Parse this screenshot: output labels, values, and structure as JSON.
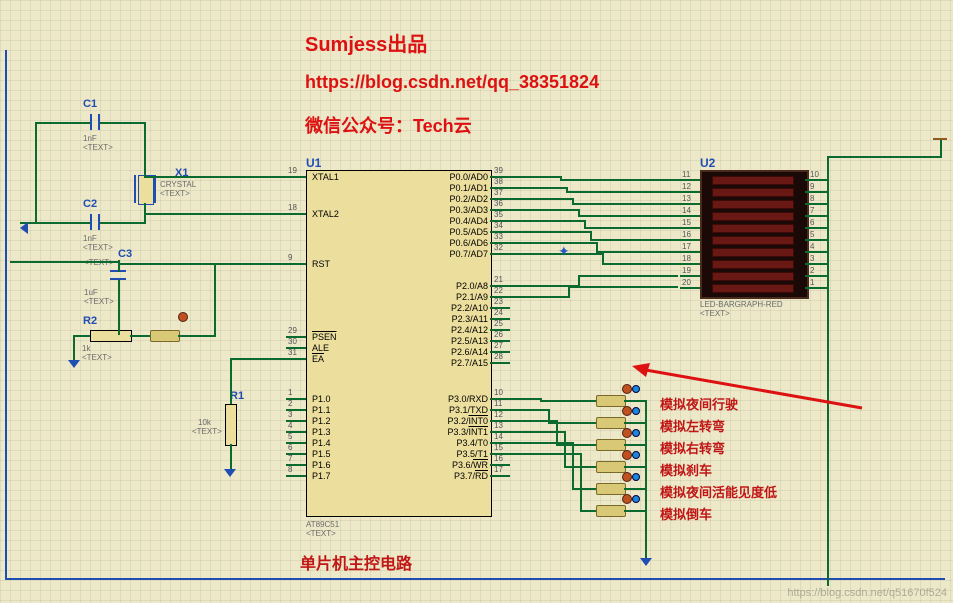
{
  "header": {
    "title": "Sumjess出品",
    "url": "https://blog.csdn.net/qq_38351824",
    "wechat": "微信公众号：Tech云"
  },
  "components": {
    "C1": {
      "ref": "C1",
      "value": "1nF",
      "text": "<TEXT>"
    },
    "C2": {
      "ref": "C2",
      "value": "1nF",
      "text": "<TEXT>"
    },
    "C3": {
      "ref": "C3",
      "value": "1uF",
      "text": "<TEXT>"
    },
    "X1": {
      "ref": "X1",
      "value": "CRYSTAL",
      "text": "<TEXT>"
    },
    "R1": {
      "ref": "R1",
      "value": "10k",
      "text": "<TEXT>"
    },
    "R2": {
      "ref": "R2",
      "value": "1k",
      "text": "<TEXT>"
    },
    "U1": {
      "ref": "U1",
      "part": "AT89C51",
      "text": "<TEXT>"
    },
    "U2": {
      "ref": "U2",
      "part": "LED-BARGRAPH-RED",
      "text": "<TEXT>"
    }
  },
  "u1_pins_left": [
    {
      "num": "19",
      "name": "XTAL1"
    },
    {
      "num": "18",
      "name": "XTAL2"
    },
    {
      "num": "9",
      "name": "RST"
    },
    {
      "num": "29",
      "name": "PSEN"
    },
    {
      "num": "30",
      "name": "ALE"
    },
    {
      "num": "31",
      "name": "EA"
    },
    {
      "num": "1",
      "name": "P1.0"
    },
    {
      "num": "2",
      "name": "P1.1"
    },
    {
      "num": "3",
      "name": "P1.2"
    },
    {
      "num": "4",
      "name": "P1.3"
    },
    {
      "num": "5",
      "name": "P1.4"
    },
    {
      "num": "6",
      "name": "P1.5"
    },
    {
      "num": "7",
      "name": "P1.6"
    },
    {
      "num": "8",
      "name": "P1.7"
    }
  ],
  "u1_pins_right": [
    {
      "num": "39",
      "name": "P0.0/AD0"
    },
    {
      "num": "38",
      "name": "P0.1/AD1"
    },
    {
      "num": "37",
      "name": "P0.2/AD2"
    },
    {
      "num": "36",
      "name": "P0.3/AD3"
    },
    {
      "num": "35",
      "name": "P0.4/AD4"
    },
    {
      "num": "34",
      "name": "P0.5/AD5"
    },
    {
      "num": "33",
      "name": "P0.6/AD6"
    },
    {
      "num": "32",
      "name": "P0.7/AD7"
    },
    {
      "num": "21",
      "name": "P2.0/A8"
    },
    {
      "num": "22",
      "name": "P2.1/A9"
    },
    {
      "num": "23",
      "name": "P2.2/A10"
    },
    {
      "num": "24",
      "name": "P2.3/A11"
    },
    {
      "num": "25",
      "name": "P2.4/A12"
    },
    {
      "num": "26",
      "name": "P2.5/A13"
    },
    {
      "num": "27",
      "name": "P2.6/A14"
    },
    {
      "num": "28",
      "name": "P2.7/A15"
    },
    {
      "num": "10",
      "name": "P3.0/RXD"
    },
    {
      "num": "11",
      "name": "P3.1/TXD"
    },
    {
      "num": "12",
      "name": "P3.2/INT0"
    },
    {
      "num": "13",
      "name": "P3.3/INT1"
    },
    {
      "num": "14",
      "name": "P3.4/T0"
    },
    {
      "num": "15",
      "name": "P3.5/T1"
    },
    {
      "num": "16",
      "name": "P3.6/WR"
    },
    {
      "num": "17",
      "name": "P3.7/RD"
    }
  ],
  "u2_pins_left": [
    "11",
    "12",
    "13",
    "14",
    "15",
    "16",
    "17",
    "18",
    "19",
    "20"
  ],
  "u2_pins_right": [
    "10",
    "9",
    "8",
    "7",
    "6",
    "5",
    "4",
    "3",
    "2",
    "1"
  ],
  "switches": [
    {
      "label": "模拟夜间行驶"
    },
    {
      "label": "模拟左转弯"
    },
    {
      "label": "模拟右转弯"
    },
    {
      "label": "模拟刹车"
    },
    {
      "label": "模拟夜间活能见度低"
    },
    {
      "label": "模拟倒车"
    }
  ],
  "caption": "单片机主控电路",
  "overline_pins": {
    "INT0": true,
    "INT1": true,
    "WR": true,
    "RD": true,
    "PSEN": true,
    "EA": true
  },
  "watermark": "https://blog.csdn.net/q51670f524"
}
